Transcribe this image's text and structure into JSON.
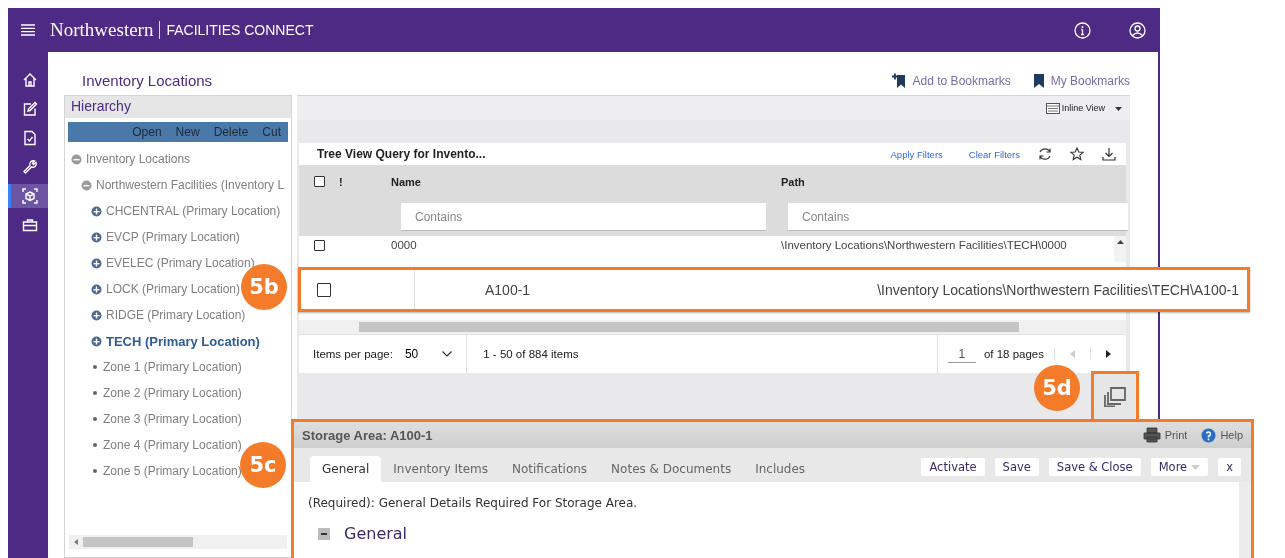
{
  "header": {
    "brand": "Northwestern",
    "product": "FACILITIES CONNECT"
  },
  "nav_rail": {
    "items": [
      {
        "kind": "home",
        "selected": false
      },
      {
        "kind": "edit",
        "selected": false
      },
      {
        "kind": "document",
        "selected": false
      },
      {
        "kind": "wrench",
        "selected": false
      },
      {
        "kind": "cube",
        "selected": true
      },
      {
        "kind": "briefcase",
        "selected": false
      }
    ]
  },
  "page": {
    "title": "Inventory Locations",
    "actions": [
      {
        "kind": "add-bookmark",
        "label": "Add to Bookmarks"
      },
      {
        "kind": "bookmark",
        "label": "My Bookmarks"
      }
    ]
  },
  "hierarchy": {
    "title": "Hierarchy",
    "toolbar": [
      "Open",
      "New",
      "Delete",
      "Cut"
    ],
    "tree": [
      {
        "label": "Inventory Locations",
        "kind": "node",
        "expanded": true,
        "selected": false,
        "children": [
          {
            "label": "Northwestern Facilities (Inventory L",
            "kind": "node",
            "expanded": true,
            "selected": false,
            "children": [
              {
                "label": "CHCENTRAL (Primary Location)",
                "kind": "node",
                "expanded": false,
                "selected": false
              },
              {
                "label": "EVCP (Primary Location)",
                "kind": "node",
                "expanded": false,
                "selected": false
              },
              {
                "label": "EVELEC (Primary Location)",
                "kind": "node",
                "expanded": false,
                "selected": false
              },
              {
                "label": "LOCK (Primary Location)",
                "kind": "node",
                "expanded": false,
                "selected": false
              },
              {
                "label": "RIDGE (Primary Location)",
                "kind": "node",
                "expanded": false,
                "selected": false
              },
              {
                "label": "TECH (Primary Location)",
                "kind": "node",
                "expanded": false,
                "selected": true
              },
              {
                "label": "Zone 1 (Primary Location)",
                "kind": "leaf",
                "selected": false
              },
              {
                "label": "Zone 2 (Primary Location)",
                "kind": "leaf",
                "selected": false
              },
              {
                "label": "Zone 3 (Primary Location)",
                "kind": "leaf",
                "selected": false
              },
              {
                "label": "Zone 4 (Primary Location)",
                "kind": "leaf",
                "selected": false
              },
              {
                "label": "Zone 5 (Primary Location)",
                "kind": "leaf",
                "selected": false
              }
            ]
          }
        ]
      }
    ]
  },
  "view_menu": {
    "label": "Inline View"
  },
  "query": {
    "title": "Tree View Query for Invento...",
    "links": [
      "Apply Filters",
      "Clear Filters"
    ],
    "select_all": {
      "checked": false
    },
    "columns": [
      {
        "label": "!"
      },
      {
        "label": "Name"
      },
      {
        "label": "Path"
      }
    ],
    "filters": [
      {
        "placeholder": "Contains"
      },
      {
        "placeholder": "Contains"
      }
    ],
    "rows": [
      {
        "name": "0000",
        "path": "\\Inventory Locations\\Northwestern Facilities\\TECH\\0000",
        "checked": false
      }
    ],
    "items_per_page_label": "Items per page:",
    "items_per_page": "50",
    "range": "1 - 50 of 884 items",
    "page": "1",
    "page_count": "of 18 pages"
  },
  "highlighted_row": {
    "callout": "5b",
    "name": "A100-1",
    "path": "\\Inventory Locations\\Northwestern Facilities\\TECH\\A100-1",
    "checked": false
  },
  "popout": {
    "callout": "5d"
  },
  "detail": {
    "callout": "5c",
    "title": "Storage Area: A100-1",
    "print": "Print",
    "help": "Help",
    "tabs": [
      {
        "label": "General",
        "selected": true
      },
      {
        "label": "Inventory Items",
        "selected": false
      },
      {
        "label": "Notifications",
        "selected": false
      },
      {
        "label": "Notes & Documents",
        "selected": false
      },
      {
        "label": "Includes",
        "selected": false
      }
    ],
    "buttons": [
      {
        "label": "Activate",
        "kind": "plain"
      },
      {
        "label": "Save",
        "kind": "plain"
      },
      {
        "label": "Save & Close",
        "kind": "plain"
      },
      {
        "label": "More",
        "kind": "menu"
      },
      {
        "label": "x",
        "kind": "plain"
      }
    ],
    "message": "(Required): General Details Required For Storage Area.",
    "section": "General"
  }
}
